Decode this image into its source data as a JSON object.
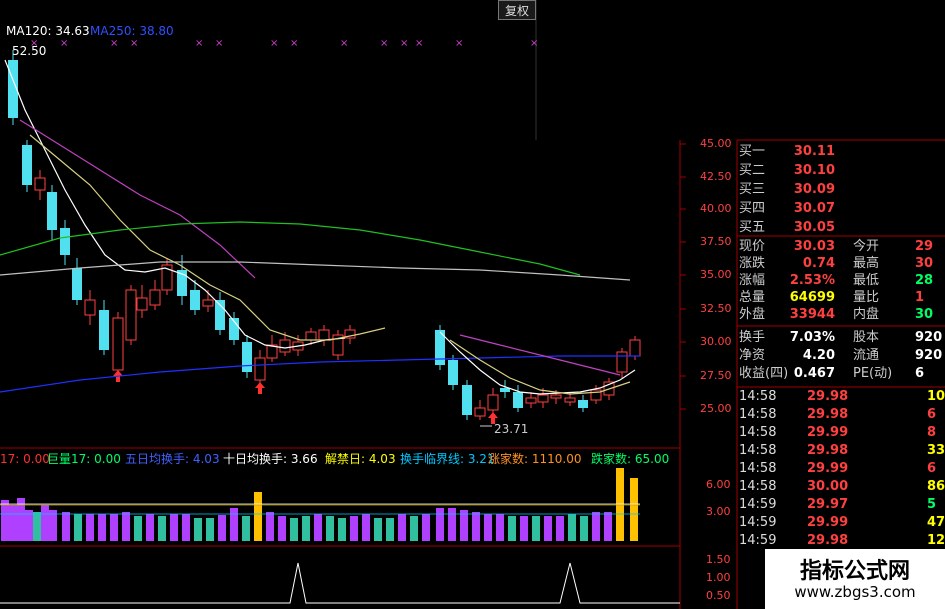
{
  "top": {
    "ma120": "MA120: 34.63",
    "ma250": "MA250: 38.80",
    "restore_button": "复权",
    "high_mark": "52.50",
    "low_mark": "23.71"
  },
  "price_axis": [
    "45.00",
    "42.50",
    "40.00",
    "37.50",
    "35.00",
    "32.50",
    "30.00",
    "27.50",
    "25.00"
  ],
  "indicator_axis": [
    "6.00",
    "3.00"
  ],
  "bottom_axis": [
    "1.50",
    "1.00",
    "0.50"
  ],
  "indicator_bar": [
    {
      "text": "17: 0.00",
      "color": "#ff3030"
    },
    {
      "text": "巨量17: 0.00",
      "color": "#00ff66"
    },
    {
      "text": "五日均换手: 4.03",
      "color": "#4060ff"
    },
    {
      "text": "十日均换手: 3.66",
      "color": "#ffffff"
    },
    {
      "text": "解禁日: 4.03",
      "color": "#ffff00"
    },
    {
      "text": "换手临界线: 3.21",
      "color": "#00c8ff"
    },
    {
      "text": "涨家数: 1110.00",
      "color": "#ff9020"
    },
    {
      "text": "跌家数: 65.00",
      "color": "#00ff66"
    }
  ],
  "quote": {
    "bids": [
      {
        "label": "买一",
        "price": "30.11"
      },
      {
        "label": "买二",
        "price": "30.10"
      },
      {
        "label": "买三",
        "price": "30.09"
      },
      {
        "label": "买四",
        "price": "30.07"
      },
      {
        "label": "买五",
        "price": "30.05"
      }
    ],
    "stats": [
      {
        "l1": "现价",
        "v1": "30.03",
        "c1": "#ff4040",
        "l2": "今开",
        "v2": "29",
        "c2": "#ff4040"
      },
      {
        "l1": "涨跌",
        "v1": "0.74",
        "c1": "#ff4040",
        "l2": "最高",
        "v2": "30",
        "c2": "#ff4040"
      },
      {
        "l1": "涨幅",
        "v1": "2.53%",
        "c1": "#ff4040",
        "l2": "最低",
        "v2": "28",
        "c2": "#00ff66"
      },
      {
        "l1": "总量",
        "v1": "64699",
        "c1": "#ffff00",
        "l2": "量比",
        "v2": "1",
        "c2": "#ff4040"
      },
      {
        "l1": "外盘",
        "v1": "33944",
        "c1": "#ff4040",
        "l2": "内盘",
        "v2": "30",
        "c2": "#00ff66"
      }
    ],
    "stats2": [
      {
        "l1": "换手",
        "v1": "7.03%",
        "c1": "#ffffff",
        "l2": "股本",
        "v2": "920",
        "c2": "#ffffff"
      },
      {
        "l1": "净资",
        "v1": "4.20",
        "c1": "#ffffff",
        "l2": "流通",
        "v2": "920",
        "c2": "#ffffff"
      },
      {
        "l1": "收益(四)",
        "v1": "0.467",
        "c1": "#ffffff",
        "l2": "PE(动)",
        "v2": "6",
        "c2": "#ffffff"
      }
    ],
    "ticks": [
      {
        "time": "14:58",
        "price": "29.98",
        "pc": "#ff4040",
        "vol": "10",
        "vc": "#ffff00"
      },
      {
        "time": "14:58",
        "price": "29.98",
        "pc": "#ff4040",
        "vol": "6",
        "vc": "#ff4040"
      },
      {
        "time": "14:58",
        "price": "29.99",
        "pc": "#ff4040",
        "vol": "8",
        "vc": "#ff4040"
      },
      {
        "time": "14:58",
        "price": "29.98",
        "pc": "#ff4040",
        "vol": "33",
        "vc": "#ffff00"
      },
      {
        "time": "14:58",
        "price": "29.99",
        "pc": "#ff4040",
        "vol": "6",
        "vc": "#ff4040"
      },
      {
        "time": "14:58",
        "price": "30.00",
        "pc": "#ff4040",
        "vol": "86",
        "vc": "#ffff00"
      },
      {
        "time": "14:59",
        "price": "29.97",
        "pc": "#ff4040",
        "vol": "5",
        "vc": "#00ff66"
      },
      {
        "time": "14:59",
        "price": "29.99",
        "pc": "#ff4040",
        "vol": "47",
        "vc": "#ffff00"
      },
      {
        "time": "14:59",
        "price": "29.98",
        "pc": "#ff4040",
        "vol": "12",
        "vc": "#ffff00"
      }
    ]
  },
  "watermark": {
    "title": "指标公式网",
    "url": "www.zbgs3.com"
  }
}
